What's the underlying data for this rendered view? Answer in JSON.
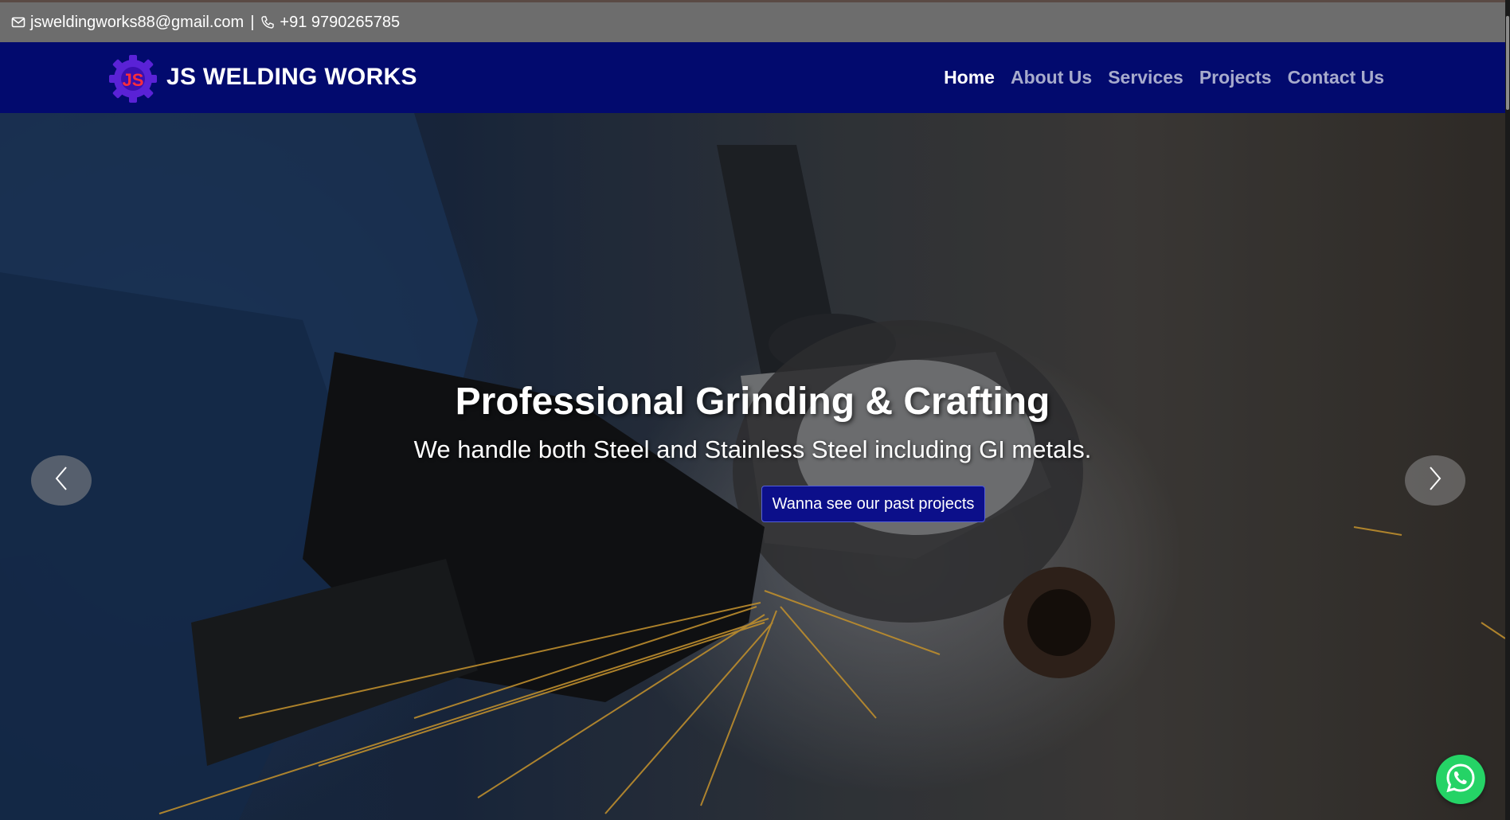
{
  "topbar": {
    "email": "jsweldingworks88@gmail.com",
    "separator": "|",
    "phone": "+91 9790265785"
  },
  "brand": {
    "logo_icon": "gear-js-logo",
    "name": "JS WELDING WORKS"
  },
  "nav": {
    "items": [
      {
        "label": "Home",
        "active": true
      },
      {
        "label": "About Us",
        "active": false
      },
      {
        "label": "Services",
        "active": false
      },
      {
        "label": "Projects",
        "active": false
      },
      {
        "label": "Contact Us",
        "active": false
      }
    ]
  },
  "hero": {
    "title": "Professional Grinding & Crafting",
    "subtitle": "We handle both Steel and Stainless Steel including GI metals.",
    "button_label": "Wanna see our past projects",
    "prev_icon": "chevron-left-icon",
    "next_icon": "chevron-right-icon"
  },
  "whatsapp": {
    "icon": "whatsapp-icon"
  },
  "colors": {
    "topbar_bg": "#6d6d6d",
    "navbar_bg": "#020a6e",
    "nav_inactive": "#a7abcc",
    "nav_active": "#ffffff",
    "button_bg": "#0c0f8a",
    "whatsapp_green": "#25d366"
  }
}
